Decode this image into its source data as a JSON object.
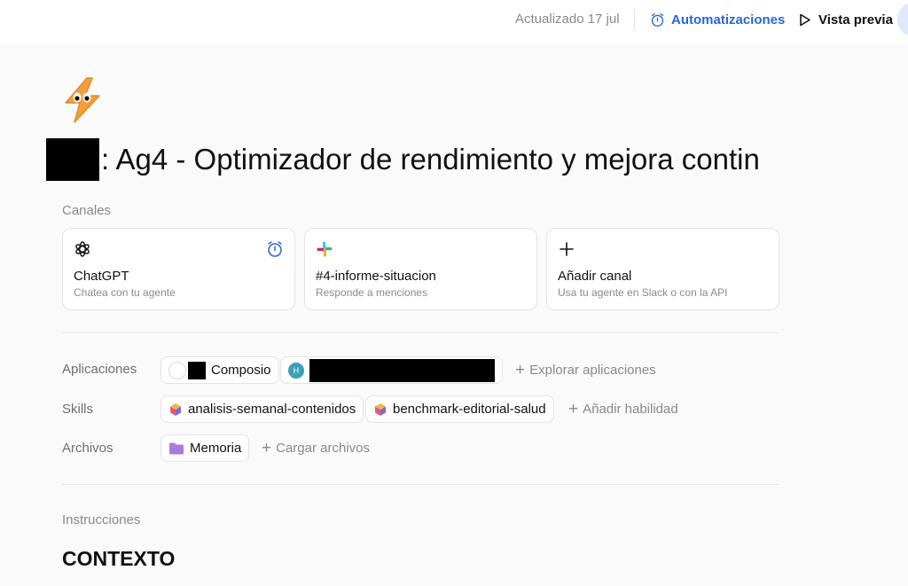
{
  "topbar": {
    "updated": "Actualizado 17 jul",
    "automations_label": "Automatizaciones",
    "preview_label": "Vista previa"
  },
  "agent": {
    "title": ": Ag4 - Optimizador de rendimiento y mejora contin"
  },
  "channels": {
    "label": "Canales",
    "items": [
      {
        "title": "ChatGPT",
        "subtitle": "Chatea con tu agente"
      },
      {
        "title": "#4-informe-situacion",
        "subtitle": "Responde a menciones"
      },
      {
        "title": "Añadir canal",
        "subtitle": "Usa tu agente en Slack o con la API"
      }
    ]
  },
  "apps": {
    "label": "Aplicaciones",
    "items": [
      {
        "name": "Composio"
      },
      {
        "badge": "H"
      }
    ],
    "add_label": "Explorar aplicaciones"
  },
  "skills": {
    "label": "Skills",
    "items": [
      {
        "name": "analisis-semanal-contenidos"
      },
      {
        "name": "benchmark-editorial-salud"
      }
    ],
    "add_label": "Añadir habilidad"
  },
  "files": {
    "label": "Archivos",
    "items": [
      {
        "name": "Memoria"
      }
    ],
    "add_label": "Cargar archivos"
  },
  "instructions": {
    "label": "Instrucciones",
    "heading": "CONTEXTO"
  },
  "colors": {
    "accent": "#2a66d9",
    "logo": "#f3a03b",
    "folder": "#a87be0"
  }
}
